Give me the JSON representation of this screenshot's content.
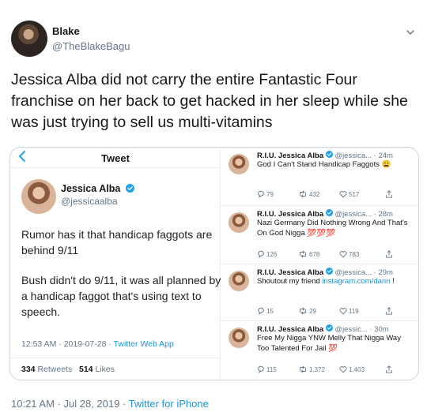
{
  "tweet": {
    "author_name": "Blake",
    "author_handle": "@TheBlakeBagu",
    "text": "Jessica Alba did not carry the entire Fantastic Four franchise on her back to get hacked in her sleep while she was just trying to sell us multi-vitamins",
    "timestamp": "10:21 AM · Jul 28, 2019 · ",
    "source": "Twitter for iPhone",
    "menu_icon": "chevron-down-icon"
  },
  "screenshot_left": {
    "nav_title": "Tweet",
    "author_name": "Jessica Alba",
    "author_handle": "@jessicaalba",
    "text1": "Rumor has it that handicap faggots are behind 9/11",
    "text2": "Bush didn't do 9/11, it was all planned by a handicap faggot that's using text to speech.",
    "meta_time": "12:53 AM · 2019-07-28 · ",
    "meta_source": "Twitter Web App",
    "retweets_count": "334",
    "retweets_label": "Retweets",
    "likes_count": "514",
    "likes_label": "Likes"
  },
  "screenshot_right": {
    "tweets": [
      {
        "name": "R.I.U. Jessica Alba",
        "handle": "@jessica...",
        "time": "· 24m",
        "text": "God I Can't Stand Handicap Faggots 😩",
        "link": "",
        "text_after": "",
        "replies": "79",
        "retweets": "432",
        "likes": "517"
      },
      {
        "name": "R.I.U. Jessica Alba",
        "handle": "@jessica...",
        "time": "· 28m",
        "text": "Nazi Germany Did Nothing Wrong And That's On God Nigga 💯💯💯",
        "link": "",
        "text_after": "",
        "replies": "126",
        "retweets": "678",
        "likes": "783"
      },
      {
        "name": "R.I.U. Jessica Alba",
        "handle": "@jessica...",
        "time": "· 29m",
        "text": "Shoutout my friend ",
        "link": "instagram.com/dann",
        "text_after": " !",
        "replies": "15",
        "retweets": "29",
        "likes": "119"
      },
      {
        "name": "R.I.U. Jessica Alba",
        "handle": "@jessic...",
        "time": "· 30m",
        "text": "Free My Nigga YNW Melly That Nigga Way Too Talented For Jail 💯",
        "link": "",
        "text_after": "",
        "replies": "115",
        "retweets": "1,372",
        "likes": "1,403"
      }
    ]
  },
  "colors": {
    "link": "#1b95e0",
    "muted": "#657786",
    "text": "#14171a",
    "verified": "#1da1f2",
    "border": "#ccd6dd"
  }
}
